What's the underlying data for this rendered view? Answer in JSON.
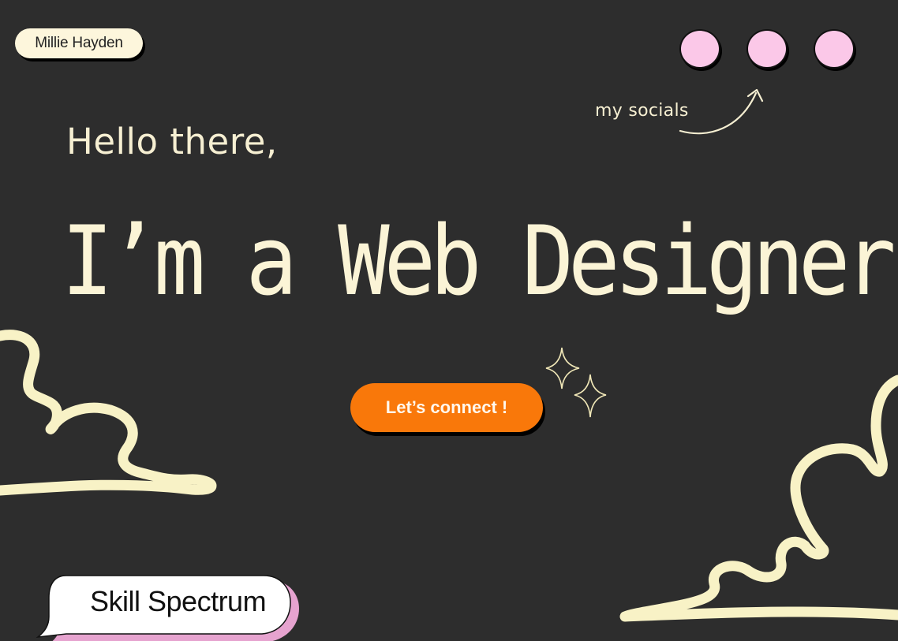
{
  "header": {
    "name_badge": "Millie Hayden",
    "socials_label": "my socials",
    "social_buttons": [
      "social-link-1",
      "social-link-2",
      "social-link-3"
    ]
  },
  "hero": {
    "greeting": "Hello there,",
    "headline": "I’m a Web Designer",
    "cta_label": "Let’s connect !"
  },
  "footer": {
    "section_label": "Skill Spectrum"
  },
  "colors": {
    "background": "#2d2d2d",
    "cream": "#fbf4d6",
    "social_pink": "#fbc8e8",
    "accent_orange": "#f9780a",
    "bubble_shadow_pink": "#e6a3cf"
  },
  "icons": [
    "curved-arrow-icon",
    "sparkle-icon",
    "cloud-doodle-left",
    "cloud-doodle-right",
    "speech-bubble"
  ]
}
